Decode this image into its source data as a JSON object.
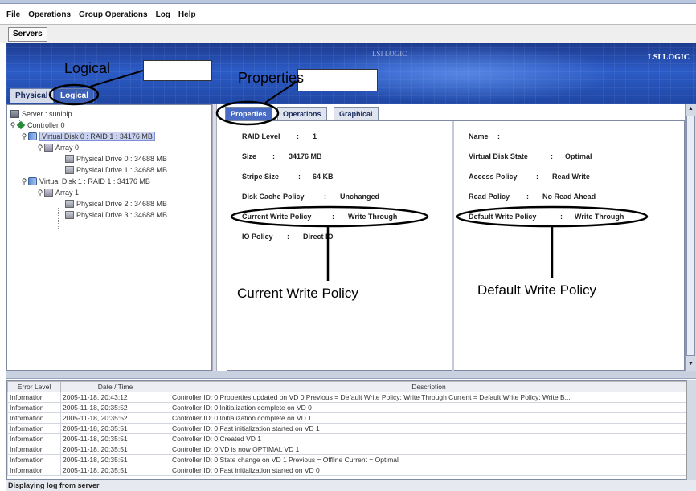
{
  "menu": [
    "File",
    "Operations",
    "Group Operations",
    "Log",
    "Help"
  ],
  "toolbar": {
    "servers_label": "Servers"
  },
  "banner": {
    "brand": "LSI LOGIC",
    "brand_faint": "LSI LOGIC"
  },
  "view_tabs": {
    "physical": "Physical",
    "logical": "Logical"
  },
  "tree": [
    {
      "label": "Server : sunipip",
      "icon": "server"
    },
    {
      "label": "Controller 0",
      "icon": "controller"
    },
    {
      "label": "Virtual Disk 0 : RAID 1 : 34176 MB",
      "icon": "virtual-disk",
      "selected": true
    },
    {
      "label": "Array 0",
      "icon": "array"
    },
    {
      "label": "Physical Drive 0 : 34688 MB",
      "icon": "physical-drive"
    },
    {
      "label": "Physical Drive 1 : 34688 MB",
      "icon": "physical-drive"
    },
    {
      "label": "Virtual Disk 1 : RAID 1 : 34176 MB",
      "icon": "virtual-disk"
    },
    {
      "label": "Array 1",
      "icon": "array"
    },
    {
      "label": "Physical Drive 2 : 34688 MB",
      "icon": "physical-drive"
    },
    {
      "label": "Physical Drive 3 : 34688 MB",
      "icon": "physical-drive"
    }
  ],
  "right_tabs": {
    "properties": "Properties",
    "operations": "Operations",
    "graphical": "Graphical View"
  },
  "properties_left": [
    {
      "key": "RAID Level",
      "value": "1"
    },
    {
      "key": "Size",
      "value": "34176 MB"
    },
    {
      "key": "Stripe Size",
      "value": "64 KB"
    },
    {
      "key": "Disk Cache Policy",
      "value": "Unchanged"
    },
    {
      "key": "Current Write Policy",
      "value": "Write Through"
    },
    {
      "key": "IO Policy",
      "value": "Direct IO"
    }
  ],
  "properties_right": [
    {
      "key": "Name",
      "value": ""
    },
    {
      "key": "Virtual Disk State",
      "value": "Optimal"
    },
    {
      "key": "Access Policy",
      "value": "Read Write"
    },
    {
      "key": "Read Policy",
      "value": "No Read Ahead"
    },
    {
      "key": "Default Write Policy",
      "value": "Write Through"
    }
  ],
  "log": {
    "headers": [
      "Error Level",
      "Date / Time",
      "Description"
    ],
    "rows": [
      [
        "Information",
        "2005-11-18, 20:43:12",
        "Controller ID:  0   Properties updated on VD   0  Previous  =   Default Write Policy: Write Through   Current  =   Default Write Policy: Write B..."
      ],
      [
        "Information",
        "2005-11-18, 20:35:52",
        "Controller ID:  0   Initialization complete on VD   0"
      ],
      [
        "Information",
        "2005-11-18, 20:35:52",
        "Controller ID:  0   Initialization complete on VD   1"
      ],
      [
        "Information",
        "2005-11-18, 20:35:51",
        "Controller ID:  0   Fast initialization started on VD   1"
      ],
      [
        "Information",
        "2005-11-18, 20:35:51",
        "Controller ID:  0   Created VD   1"
      ],
      [
        "Information",
        "2005-11-18, 20:35:51",
        "Controller ID:  0   VD is now OPTIMAL   VD   1"
      ],
      [
        "Information",
        "2005-11-18, 20:35:51",
        "Controller ID:  0   State change on VD   1  Previous  =   Offline   Current  =   Optimal"
      ],
      [
        "Information",
        "2005-11-18, 20:35:51",
        "Controller ID:  0   Fast initialization started on VD   0"
      ]
    ]
  },
  "status": "Displaying log from server",
  "annotations": {
    "logical": "Logical",
    "properties": "Properties",
    "current_write_policy": "Current Write Policy",
    "default_write_policy": "Default Write Policy"
  }
}
